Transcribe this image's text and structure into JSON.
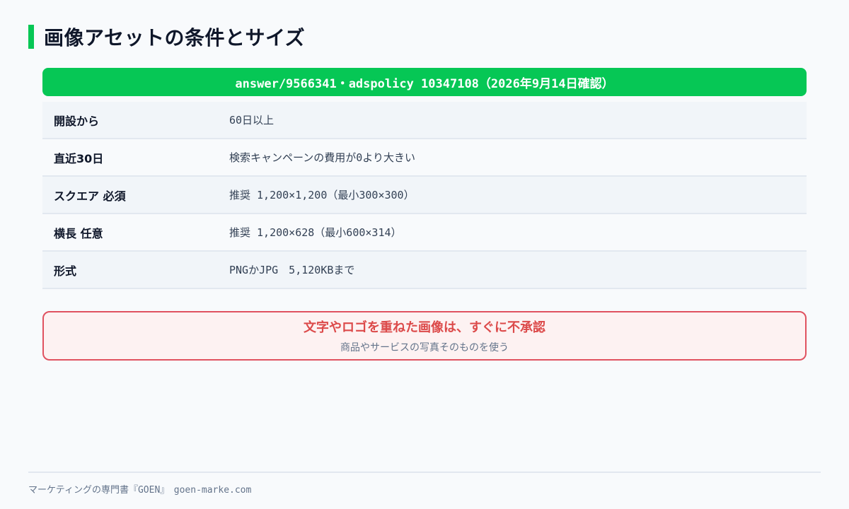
{
  "title": "画像アセットの条件とサイズ",
  "banner": "answer/9566341・adspolicy 10347108（2026年9月14日確認）",
  "rows": [
    {
      "label": "開設から",
      "value": "60日以上"
    },
    {
      "label": "直近30日",
      "value": "検索キャンペーンの費用が0より大きい"
    },
    {
      "label": "スクエア 必須",
      "value": "推奨 1,200×1,200（最小300×300）"
    },
    {
      "label": "横長 任意",
      "value": "推奨 1,200×628（最小600×314）"
    },
    {
      "label": "形式",
      "value": "PNGかJPG　5,120KBまで"
    }
  ],
  "warning": {
    "title": "文字やロゴを重ねた画像は、すぐに不承認",
    "subtitle": "商品やサービスの写真そのものを使う"
  },
  "footer": "マーケティングの専門書『GOEN』　goen-marke.com",
  "colors": {
    "accent": "#06c755",
    "warning": "#dc4a4a"
  }
}
